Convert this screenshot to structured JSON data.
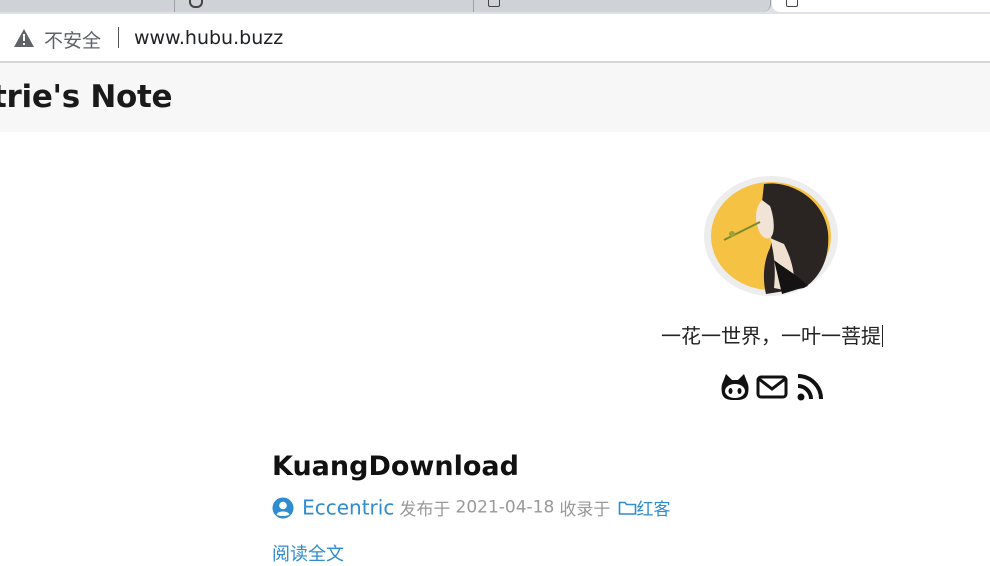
{
  "browser": {
    "security_label": "不安全",
    "url": "www.hubu.buzz"
  },
  "site": {
    "title": "trie's Note"
  },
  "profile": {
    "motto": "一花一世界，一叶一菩提",
    "social": [
      {
        "icon": "github-icon"
      },
      {
        "icon": "email-icon"
      },
      {
        "icon": "rss-icon"
      }
    ]
  },
  "post": {
    "title": "KuangDownload",
    "author": "Eccentric",
    "published_prefix": "发布于",
    "date": "2021-04-18",
    "category_prefix": "收录于",
    "category": "红客",
    "read_more": "阅读全文"
  },
  "colors": {
    "link": "#2e8ccf",
    "meta_gray": "#999999",
    "header_bg": "#f7f7f7",
    "avatar_yellow": "#f6c244"
  }
}
